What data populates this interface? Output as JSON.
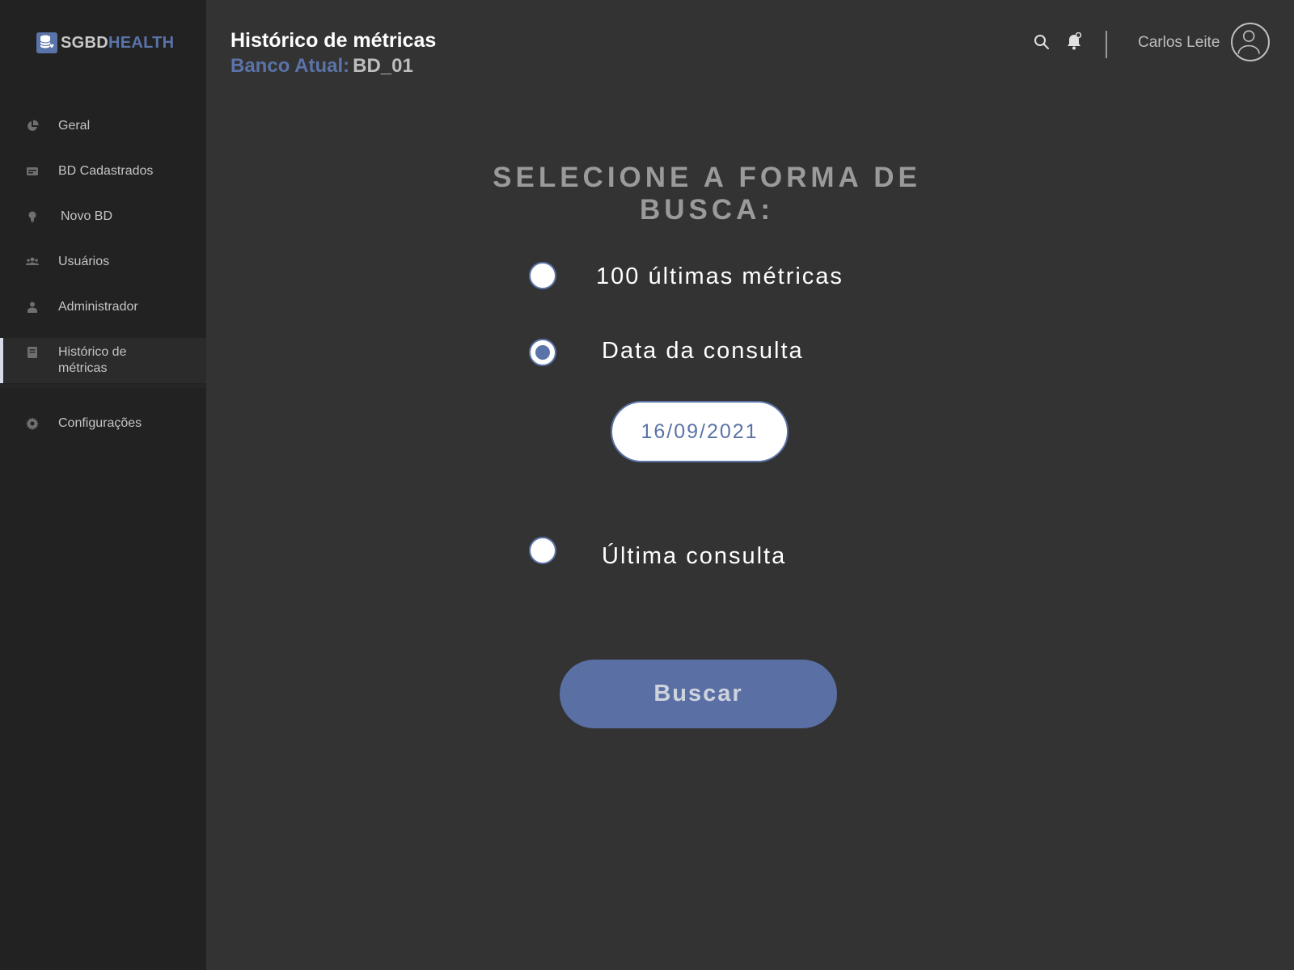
{
  "brand": {
    "part1": "SGBD",
    "part2": "HEALTH"
  },
  "sidebar": {
    "items": [
      {
        "label": "Geral",
        "icon": "pie-chart-icon"
      },
      {
        "label": "BD Cadastrados",
        "icon": "database-card-icon"
      },
      {
        "label": "Novo BD",
        "icon": "lightbulb-icon"
      },
      {
        "label": "Usuários",
        "icon": "users-icon"
      },
      {
        "label": "Administrador",
        "icon": "admin-user-icon"
      },
      {
        "label_line1": "Histórico de",
        "label_line2": "métricas",
        "icon": "book-icon",
        "active": true
      },
      {
        "label": "Configurações",
        "icon": "gear-icon"
      }
    ]
  },
  "header": {
    "title": "Histórico de métricas",
    "db_label": "Banco Atual:",
    "db_value": "BD_01",
    "user_name": "Carlos Leite"
  },
  "main": {
    "heading": "SELECIONE A FORMA DE BUSCA:",
    "options": [
      {
        "label": "100 últimas métricas",
        "checked": false
      },
      {
        "label": "Data da consulta",
        "checked": true
      },
      {
        "label": "Última consulta",
        "checked": false
      }
    ],
    "date_value": "16/09/2021",
    "button_label": "Buscar"
  },
  "colors": {
    "background": "#333333",
    "sidebar": "#222222",
    "accent": "#5a73a8",
    "heading": "#9a9a9a"
  }
}
